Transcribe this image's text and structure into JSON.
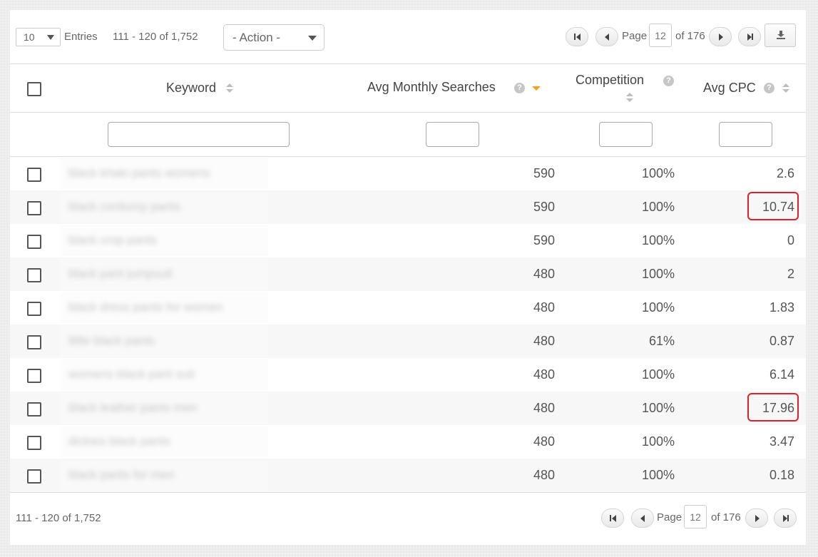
{
  "toolbar": {
    "entries_value": "10",
    "entries_label": "Entries",
    "range": "111 - 120 of 1,752",
    "action_label": "- Action -"
  },
  "pager": {
    "page_label": "Page",
    "current_page": "12",
    "of_label": "of 176"
  },
  "columns": {
    "keyword": "Keyword",
    "searches": "Avg Monthly Searches",
    "competition": "Competition",
    "cpc": "Avg CPC",
    "help_glyph": "?"
  },
  "rows": [
    {
      "keyword": "black khaki pants womens",
      "searches": "590",
      "competition": "100%",
      "cpc": "2.6",
      "highlighted": false
    },
    {
      "keyword": "black corduroy pants",
      "searches": "590",
      "competition": "100%",
      "cpc": "10.74",
      "highlighted": true
    },
    {
      "keyword": "black crop pants",
      "searches": "590",
      "competition": "100%",
      "cpc": "0",
      "highlighted": false
    },
    {
      "keyword": "black pant jumpsuit",
      "searches": "480",
      "competition": "100%",
      "cpc": "2",
      "highlighted": false
    },
    {
      "keyword": "black dress pants for women",
      "searches": "480",
      "competition": "100%",
      "cpc": "1.83",
      "highlighted": false
    },
    {
      "keyword": "little black pants",
      "searches": "480",
      "competition": "61%",
      "cpc": "0.87",
      "highlighted": false
    },
    {
      "keyword": "womens black pant suit",
      "searches": "480",
      "competition": "100%",
      "cpc": "6.14",
      "highlighted": false
    },
    {
      "keyword": "black leather pants men",
      "searches": "480",
      "competition": "100%",
      "cpc": "17.96",
      "highlighted": true
    },
    {
      "keyword": "dickies black pants",
      "searches": "480",
      "competition": "100%",
      "cpc": "3.47",
      "highlighted": false
    },
    {
      "keyword": "black pants for men",
      "searches": "480",
      "competition": "100%",
      "cpc": "0.18",
      "highlighted": false
    }
  ],
  "footer": {
    "range": "111 - 120 of 1,752"
  },
  "colors": {
    "sort_active": "#f0a020",
    "highlight_border": "#e0202a"
  }
}
